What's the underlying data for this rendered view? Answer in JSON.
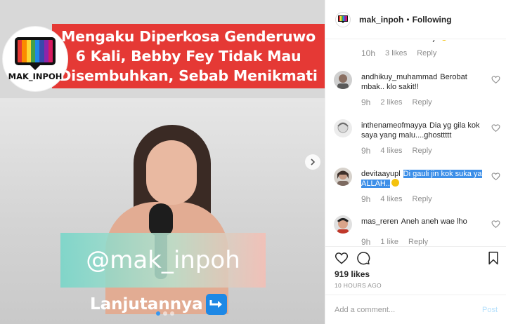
{
  "post": {
    "headline": "Mengaku Diperkosa Genderuwo 6 Kali, Bebby Fey Tidak Mau Disembuhkan, Sebab Menikmati",
    "logo_text": "MAK_INPOH",
    "handle_overlay": "@mak_inpoh",
    "cta_text": "Lanjutannya",
    "carousel": {
      "current_slide": 1,
      "total_slides": 3
    },
    "logo_stripes": [
      "#e53935",
      "#fb8c00",
      "#fdd835",
      "#43a047",
      "#1e88e5",
      "#3949ab",
      "#8e24aa",
      "#d81b60"
    ]
  },
  "header": {
    "account": "mak_inpoh",
    "separator": "•",
    "follow_status": "Following"
  },
  "first_comment_meta": {
    "time": "10h",
    "likes": "3 likes",
    "reply": "Reply"
  },
  "comments": [
    {
      "user": "andhikuy_muhammad",
      "text": "Berobat mbak.. klo sakit!!",
      "time": "9h",
      "likes": "2 likes",
      "reply": "Reply"
    },
    {
      "user": "inthenameofmayya",
      "text": "Dia yg gila kok saya yang malu....ghosttttt",
      "time": "9h",
      "likes": "4 likes",
      "reply": "Reply"
    },
    {
      "user": "devitaayupl",
      "text_highlighted": "Di gauli jin kok suka ya ALLAH..",
      "time": "9h",
      "likes": "4 likes",
      "reply": "Reply"
    },
    {
      "user": "mas_reren",
      "text": "Aneh aneh wae lho",
      "time": "9h",
      "likes": "1 like",
      "reply": "Reply"
    }
  ],
  "stats": {
    "likes": "919 likes",
    "posted": "10 HOURS AGO"
  },
  "composer": {
    "placeholder": "Add a comment...",
    "post_label": "Post"
  },
  "colors": {
    "headline_bg": "#e53935",
    "link_blue": "#3897f0",
    "selection": "#3d8fe8",
    "muted": "#8e8e8e"
  }
}
